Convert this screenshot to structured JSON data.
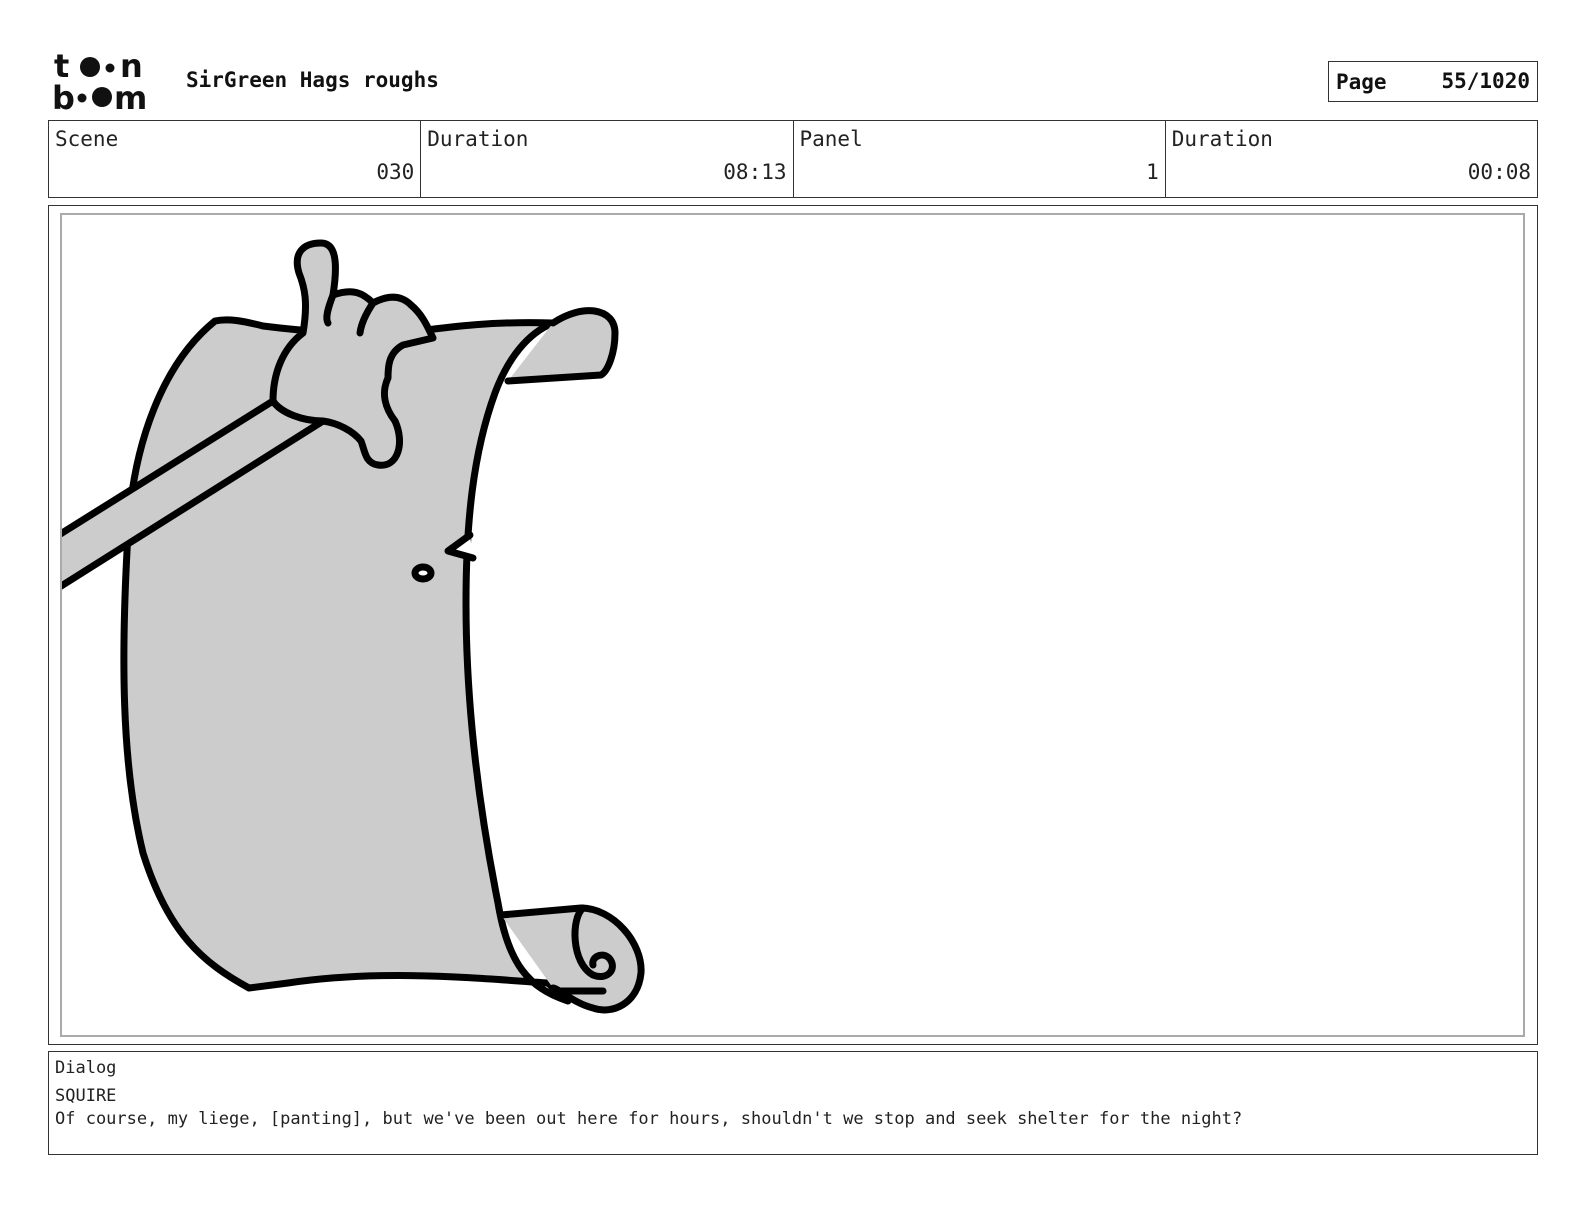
{
  "header": {
    "logo_text": "toonboom",
    "project_title": "SirGreen Hags roughs",
    "page_label": "Page",
    "page_value": "55/1020"
  },
  "info": {
    "scene_label": "Scene",
    "scene_value": "030",
    "scene_duration_label": "Duration",
    "scene_duration_value": "08:13",
    "panel_label": "Panel",
    "panel_value": "1",
    "panel_duration_label": "Duration",
    "panel_duration_value": "00:08"
  },
  "panel": {
    "drawing": "scroll-held-by-hand"
  },
  "dialog": {
    "label": "Dialog",
    "speaker": "SQUIRE",
    "line": "Of course, my liege, [panting], but we've been out here for hours, shouldn't we stop and seek shelter for the night?"
  }
}
